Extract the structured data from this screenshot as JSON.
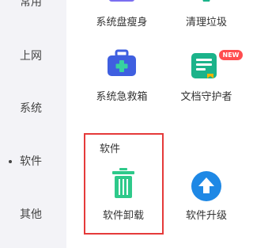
{
  "sidebar": {
    "items": [
      {
        "label": "常用",
        "active": false
      },
      {
        "label": "上网",
        "active": false
      },
      {
        "label": "系统",
        "active": false
      },
      {
        "label": "软件",
        "active": true
      },
      {
        "label": "其他",
        "active": false
      }
    ]
  },
  "tools": {
    "disk_slim": {
      "label": "系统盘瘦身",
      "icon": "disk-icon"
    },
    "clean_junk": {
      "label": "清理垃圾",
      "icon": "broom-icon"
    },
    "sys_rescue": {
      "label": "系统急救箱",
      "icon": "first-aid-kit-icon"
    },
    "doc_guard": {
      "label": "文档守护者",
      "icon": "document-guard-icon",
      "badge": "NEW"
    }
  },
  "software_section": {
    "title": "软件",
    "uninstall": {
      "label": "软件卸载",
      "icon": "trash-can-icon"
    },
    "upgrade": {
      "label": "软件升级",
      "icon": "upgrade-arrow-icon"
    }
  },
  "colors": {
    "sidebar_bg": "#f3f3f7",
    "highlight": "#e53a3a",
    "trash_green": "#2ec98a",
    "upgrade_blue": "#1e88e5",
    "kit_blue": "#3f5fe0",
    "doc_green": "#1bb38a",
    "badge_red": "#ff4d4f"
  }
}
